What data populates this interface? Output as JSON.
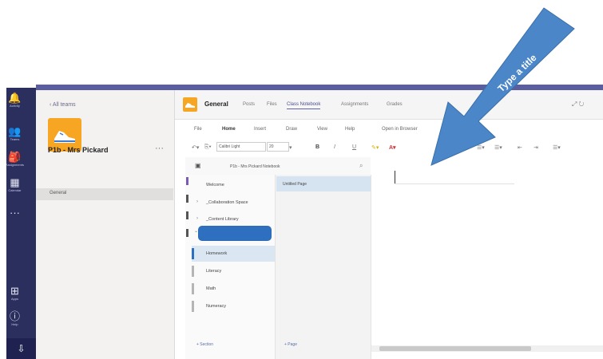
{
  "rail": {
    "items": [
      {
        "icon": "bell-icon",
        "glyph": "🔔",
        "label": "Activity"
      },
      {
        "icon": "teams-icon",
        "glyph": "👥",
        "label": "Teams"
      },
      {
        "icon": "assignments-icon",
        "glyph": "🎒",
        "label": "Assignments"
      },
      {
        "icon": "calendar-icon",
        "glyph": "▦",
        "label": "Calendar"
      },
      {
        "icon": "more-icon",
        "glyph": "···",
        "label": ""
      },
      {
        "icon": "apps-icon",
        "glyph": "⊞",
        "label": "Apps"
      },
      {
        "icon": "help-icon",
        "glyph": "ⓘ",
        "label": "Help"
      }
    ],
    "bottom_glyph": "⇩"
  },
  "teams_panel": {
    "back_link": "‹ All teams",
    "team_name": "P1b - Mrs Pickard",
    "more": "···",
    "channel": "General"
  },
  "header": {
    "channel_title": "General",
    "tabs": [
      "Posts",
      "Files",
      "Class Notebook",
      "Assignments",
      "Grades"
    ],
    "active_tab": 2,
    "window_controls": "⤢ ↻"
  },
  "ribbon": {
    "tabs": [
      "File",
      "Home",
      "Insert",
      "Draw",
      "View",
      "Help",
      "Open in Browser"
    ],
    "active_tab": 1,
    "font_name": "Calibri Light",
    "font_size": "20"
  },
  "notebook": {
    "title": "P1b - Mrs Pickard Notebook",
    "sections": [
      {
        "label": "Welcome",
        "caret": ""
      },
      {
        "label": "_Collaboration Space",
        "caret": "›"
      },
      {
        "label": "_Content Library",
        "caret": "›"
      }
    ],
    "group_sections": [
      "Homework",
      "Literacy",
      "Math",
      "Numeracy"
    ],
    "active_section": 0,
    "page": "Untitled Page",
    "add_section": "+ Section",
    "add_page": "+ Page"
  },
  "annotation": {
    "text": "Type a title",
    "color": "#4a86c8"
  },
  "colors": {
    "rail": "#2b2f5e",
    "accent": "#6264a7",
    "team_avatar": "#f6a623"
  }
}
